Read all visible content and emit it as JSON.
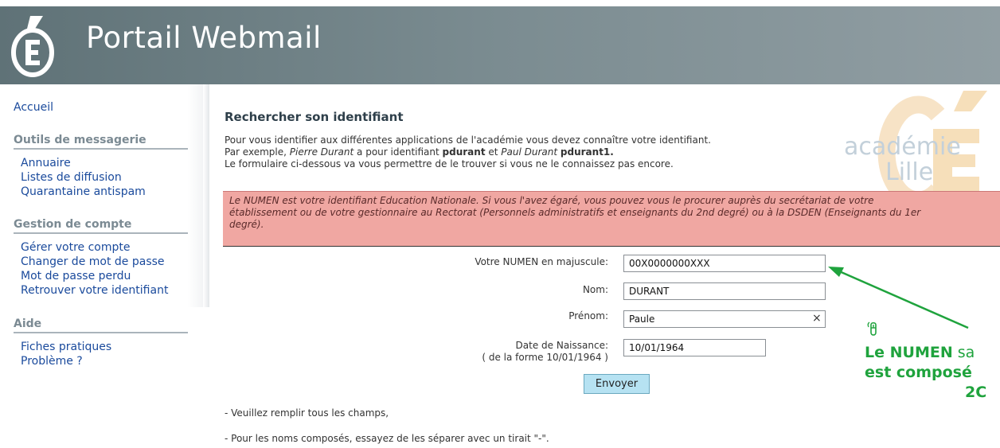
{
  "header": {
    "title": "Portail Webmail"
  },
  "sidebar": {
    "home": "Accueil",
    "sections": [
      {
        "title": "Outils de messagerie",
        "items": [
          "Annuaire",
          "Listes de diffusion",
          "Quarantaine antispam"
        ]
      },
      {
        "title": "Gestion de compte",
        "items": [
          "Gérer votre compte",
          "Changer de mot de passe",
          "Mot de passe perdu",
          "Retrouver votre identifiant"
        ]
      },
      {
        "title": "Aide",
        "items": [
          "Fiches pratiques",
          "Problème ?"
        ]
      }
    ]
  },
  "main": {
    "title": "Rechercher son identifiant",
    "intro_line1": "Pour vous identifier aux différentes applications de l'académie vous devez connaître votre identifiant.",
    "intro_line2_a": "Par exemple, ",
    "intro_line2_name1": "Pierre Durant",
    "intro_line2_b": " a pour identifiant ",
    "intro_line2_id1": "pdurant",
    "intro_line2_c": " et ",
    "intro_line2_name2": "Paul Durant",
    "intro_line2_id2": "pdurant1.",
    "intro_line3": "Le formulaire ci-dessous va vous permettre de le trouver si vous ne le connaissez pas encore.",
    "watermark_top": "académie",
    "watermark_bottom": "Lille",
    "alert_line1": "Le NUMEN est votre identifiant Education Nationale. Si vous l'avez égaré, vous pouvez vous le procurer auprès du secrétariat de votre",
    "alert_line2": "établissement ou de votre gestionnaire au Rectorat (Personnels administratifs et enseignants du 2nd degré) ou à la DSDEN (Enseignants du 1er",
    "alert_line3": "degré)."
  },
  "form": {
    "numen_label": "Votre NUMEN en majuscule:",
    "numen_value": "00X0000000XXX",
    "nom_label": "Nom:",
    "nom_value": "DURANT",
    "prenom_label": "Prénom:",
    "prenom_value": "Paule",
    "clear_glyph": "×",
    "dob_label": "Date de Naissance:",
    "dob_hint": "( de la forme 10/01/1964 )",
    "dob_value": "10/01/1964",
    "submit_label": "Envoyer"
  },
  "notes": [
    "- Veuillez remplir tous les champs,",
    "- Pour les noms composés, essayez de les séparer avec un tirait \"-\"."
  ],
  "annotation": {
    "line1_bold": "Le NUMEN",
    "line1_rest": " sa",
    "line2": "est composé",
    "line3": "2C"
  },
  "colors": {
    "annotation": "#1fa33d",
    "alert_bg": "#f0a7a2",
    "link": "#1a4a9c"
  }
}
